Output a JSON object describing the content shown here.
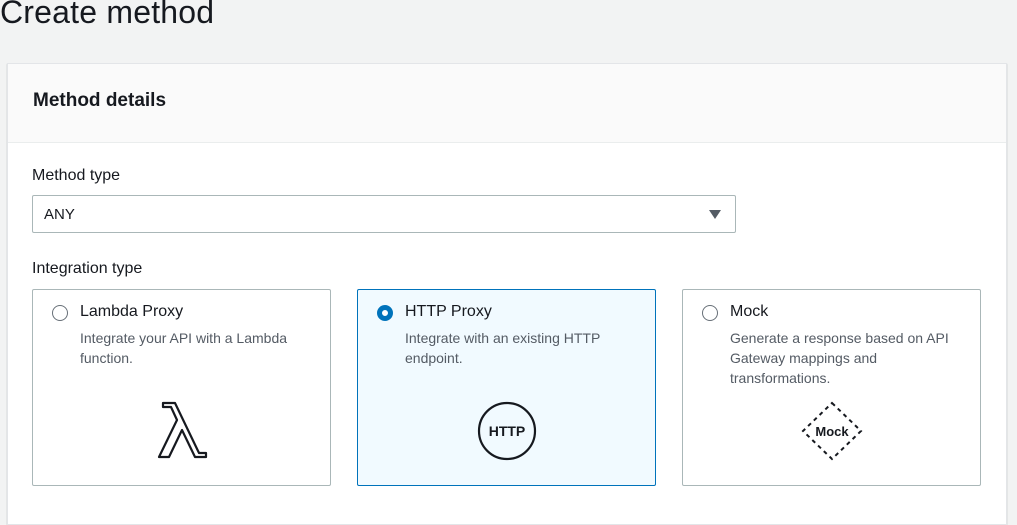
{
  "page": {
    "title": "Create method"
  },
  "method_details": {
    "title": "Method details",
    "method_type": {
      "label": "Method type",
      "value": "ANY"
    },
    "integration_type": {
      "label": "Integration type",
      "selected": "HTTP Proxy",
      "options": [
        {
          "title": "Lambda Proxy",
          "description": "Integrate your API with a Lambda function.",
          "icon": "lambda-icon",
          "selected": false
        },
        {
          "title": "HTTP Proxy",
          "description": "Integrate with an existing HTTP endpoint.",
          "icon": "http-icon",
          "icon_text": "HTTP",
          "selected": true
        },
        {
          "title": "Mock",
          "description": "Generate a response based on API Gateway mappings and transformations.",
          "icon": "mock-icon",
          "icon_text": "Mock",
          "selected": false
        }
      ]
    }
  },
  "colors": {
    "accent": "#0073bb",
    "selected_tile_bg": "#f1faff"
  }
}
